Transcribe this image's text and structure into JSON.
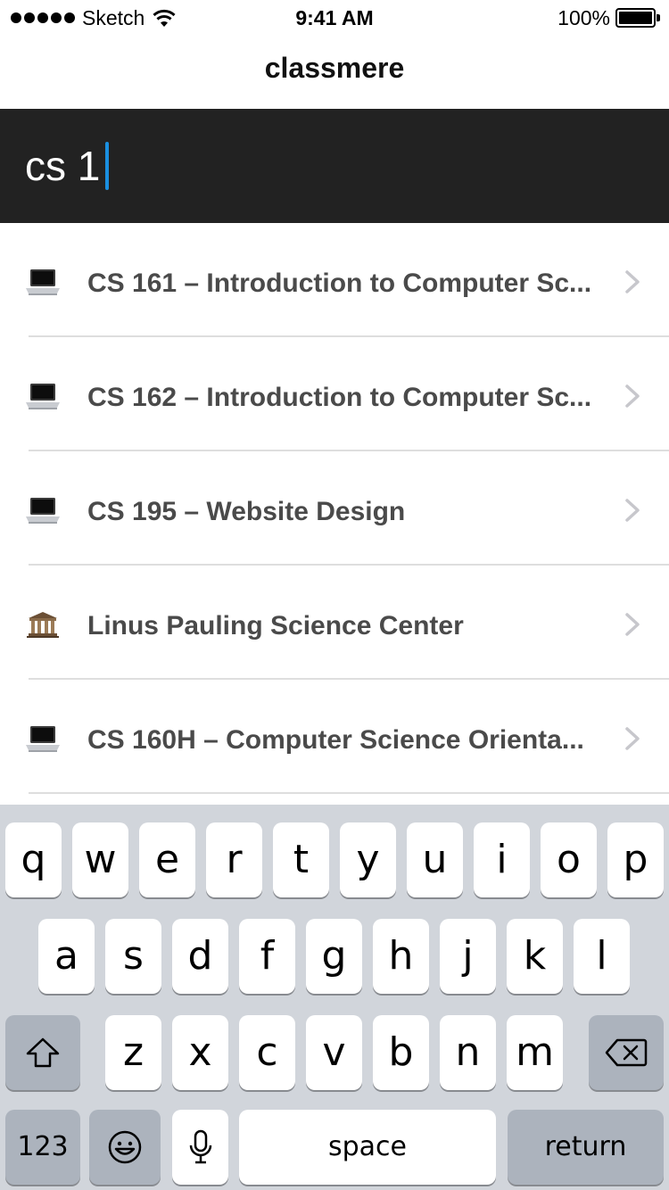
{
  "status_bar": {
    "carrier": "Sketch",
    "time": "9:41 AM",
    "battery": "100%"
  },
  "nav": {
    "title": "classmere"
  },
  "search": {
    "query": "cs 1"
  },
  "results": [
    {
      "icon": "laptop-icon",
      "label": "CS 161 – Introduction to Computer Sc..."
    },
    {
      "icon": "laptop-icon",
      "label": "CS 162 – Introduction to Computer Sc..."
    },
    {
      "icon": "laptop-icon",
      "label": "CS 195 – Website Design"
    },
    {
      "icon": "building-icon",
      "label": "Linus Pauling Science Center"
    },
    {
      "icon": "laptop-icon",
      "label": "CS 160H – Computer Science Orienta..."
    }
  ],
  "keyboard": {
    "row1": [
      "q",
      "w",
      "e",
      "r",
      "t",
      "y",
      "u",
      "i",
      "o",
      "p"
    ],
    "row2": [
      "a",
      "s",
      "d",
      "f",
      "g",
      "h",
      "j",
      "k",
      "l"
    ],
    "row3": [
      "z",
      "x",
      "c",
      "v",
      "b",
      "n",
      "m"
    ],
    "numbers_label": "123",
    "space_label": "space",
    "return_label": "return"
  },
  "colors": {
    "search_bg": "#222222",
    "caret": "#1a8fe0",
    "keyboard_bg": "#d1d5db",
    "dark_key": "#acb3bd"
  }
}
